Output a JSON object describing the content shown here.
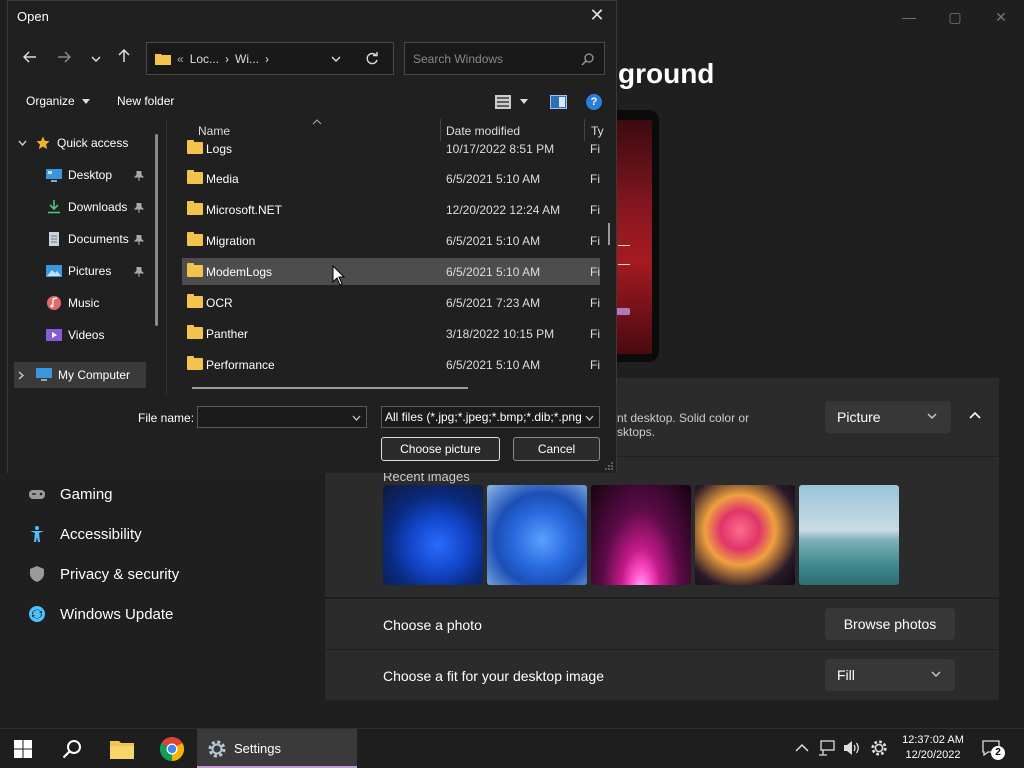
{
  "settings": {
    "title_partial": "ground",
    "nav": [
      {
        "label": "Gaming",
        "icon": "gamepad-icon",
        "color": "#9a9a9a"
      },
      {
        "label": "Accessibility",
        "icon": "accessibility-icon",
        "color": "#4cc2ff"
      },
      {
        "label": "Privacy & security",
        "icon": "shield-icon",
        "color": "#9a9a9a"
      },
      {
        "label": "Windows Update",
        "icon": "windows-update-icon",
        "color": "#4cc2ff"
      }
    ],
    "personalize_desc_line1": "nt desktop. Solid color or",
    "personalize_desc_line2": "sktops.",
    "background_type": "Picture",
    "recent_images_label": "Recent images",
    "choose_photo_label": "Choose a photo",
    "browse_photos_label": "Browse photos",
    "fit_label": "Choose a fit for your desktop image",
    "fit_value": "Fill",
    "window_controls": {
      "minimize": "—",
      "maximize": "▢",
      "close": "✕"
    }
  },
  "dialog": {
    "title": "Open",
    "close": "✕",
    "address": {
      "crumb1": "Loc...",
      "crumb2": "Wi...",
      "sep": "›",
      "prefix": "«"
    },
    "search_placeholder": "Search Windows",
    "toolbar": {
      "organize": "Organize",
      "new_folder": "New folder",
      "help": "?"
    },
    "nav": {
      "quick_access": "Quick access",
      "items": [
        {
          "label": "Desktop",
          "pinned": true
        },
        {
          "label": "Downloads",
          "pinned": true
        },
        {
          "label": "Documents",
          "pinned": true
        },
        {
          "label": "Pictures",
          "pinned": true
        },
        {
          "label": "Music",
          "pinned": false
        },
        {
          "label": "Videos",
          "pinned": false
        }
      ],
      "my_computer": "My Computer"
    },
    "columns": {
      "name": "Name",
      "date": "Date modified",
      "type": "Ty"
    },
    "files": [
      {
        "name": "Logs",
        "date": "10/17/2022 8:51 PM",
        "type": "Fi"
      },
      {
        "name": "Media",
        "date": "6/5/2021 5:10 AM",
        "type": "Fi"
      },
      {
        "name": "Microsoft.NET",
        "date": "12/20/2022 12:24 AM",
        "type": "Fi"
      },
      {
        "name": "Migration",
        "date": "6/5/2021 5:10 AM",
        "type": "Fi"
      },
      {
        "name": "ModemLogs",
        "date": "6/5/2021 5:10 AM",
        "type": "Fi",
        "selected": true
      },
      {
        "name": "OCR",
        "date": "6/5/2021 7:23 AM",
        "type": "Fi"
      },
      {
        "name": "Panther",
        "date": "3/18/2022 10:15 PM",
        "type": "Fi"
      },
      {
        "name": "Performance",
        "date": "6/5/2021 5:10 AM",
        "type": "Fi"
      }
    ],
    "file_name_label": "File name:",
    "file_name_value": "",
    "file_type_filter": "All files (*.jpg;*.jpeg;*.bmp;*.dib;*.png",
    "choose_button": "Choose picture",
    "cancel_button": "Cancel"
  },
  "taskbar": {
    "settings_label": "Settings",
    "time": "12:37:02 AM",
    "date": "12/20/2022",
    "notifications": "2"
  }
}
